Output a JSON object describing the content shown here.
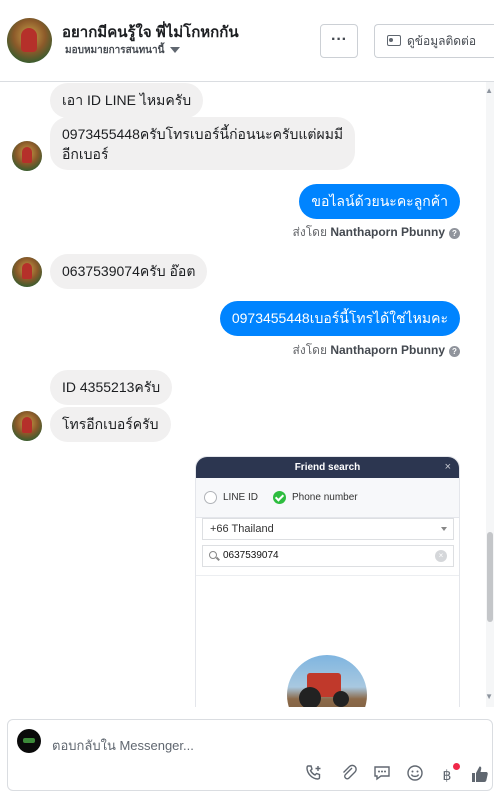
{
  "header": {
    "title": "อยากมีคนรู้ใจ พี่ไม่โกหกกัน",
    "assign_label": "มอบหมายการสนทนานี้",
    "more_label": "···",
    "contact_label": "ดูข้อมูลติดต่อ"
  },
  "messages": [
    {
      "dir": "in",
      "text": "เอา ID LINE ไหมครับ"
    },
    {
      "dir": "in",
      "line1": "0973455448ครับโทรเบอร์นี้ก่อนนะครับแต่ผมมี",
      "line2": "อีกเบอร์"
    },
    {
      "dir": "out",
      "text": "ขอไลน์ด้วยนะคะลูกค้า"
    },
    {
      "dir": "in",
      "text": "0637539074ครับ อ๊อต"
    },
    {
      "dir": "out",
      "text": "0973455448เบอร์นี้โทรได้ใช่ไหมคะ"
    },
    {
      "dir": "in",
      "text": "ID 4355213ครับ"
    },
    {
      "dir": "in",
      "text": "โทรอีกเบอร์ครับ"
    }
  ],
  "sent_by": {
    "prefix": "ส่งโดย",
    "name": "Nanthaporn Pbunny",
    "info": "?"
  },
  "attachment": {
    "title": "Friend search",
    "close": "×",
    "option_line_id": "LINE ID",
    "option_phone": "Phone number",
    "country": "+66  Thailand",
    "search_value": "0637539074",
    "clear": "×"
  },
  "composer": {
    "placeholder": "ตอบกลับใน Messenger...",
    "icons": [
      "phone-add-icon",
      "attachment-icon",
      "saved-reply-icon",
      "emoji-icon",
      "payment-icon",
      "like-icon"
    ]
  },
  "colors": {
    "accent": "#0084ff",
    "incoming": "#f1f0f0",
    "line_header": "#2c3650",
    "line_green": "#2ebd3f"
  }
}
